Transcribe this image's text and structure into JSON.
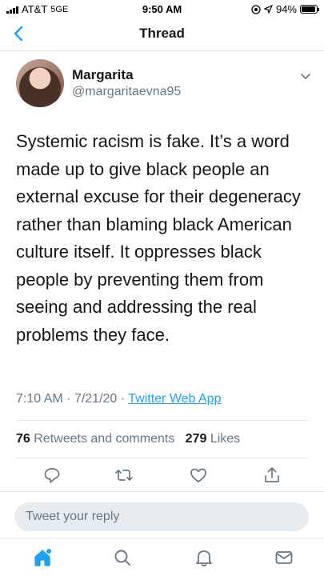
{
  "status_bar": {
    "carrier": "AT&T",
    "network": "5GE",
    "time": "9:50 AM",
    "battery": "94%",
    "battery_level": 0.94
  },
  "nav": {
    "title": "Thread"
  },
  "tweet": {
    "display_name": "Margarita",
    "handle": "@margaritaevna95",
    "text": "Systemic racism is fake. It’s a word made up to give black people an external excuse for their degeneracy rather than blaming black American culture itself. It oppresses black people by preventing them from seeing and addressing the real problems they face.",
    "time": "7:10 AM",
    "date": "7/21/20",
    "separator": "·",
    "source": "Twitter Web App",
    "retweets_count": "76",
    "retweets_label": "Retweets and comments",
    "likes_count": "279",
    "likes_label": "Likes"
  },
  "reply": {
    "placeholder": "Tweet your reply"
  },
  "icons": {
    "back": "chevron-left-icon",
    "caret": "chevron-down-icon",
    "reply": "reply-icon",
    "retweet": "retweet-icon",
    "like": "heart-icon",
    "share": "share-icon",
    "home": "home-icon",
    "search": "search-icon",
    "notifications": "bell-icon",
    "messages": "mail-icon"
  },
  "colors": {
    "accent": "#1da1f2",
    "text": "#14171a",
    "secondary": "#657786",
    "icon": "#657786"
  }
}
